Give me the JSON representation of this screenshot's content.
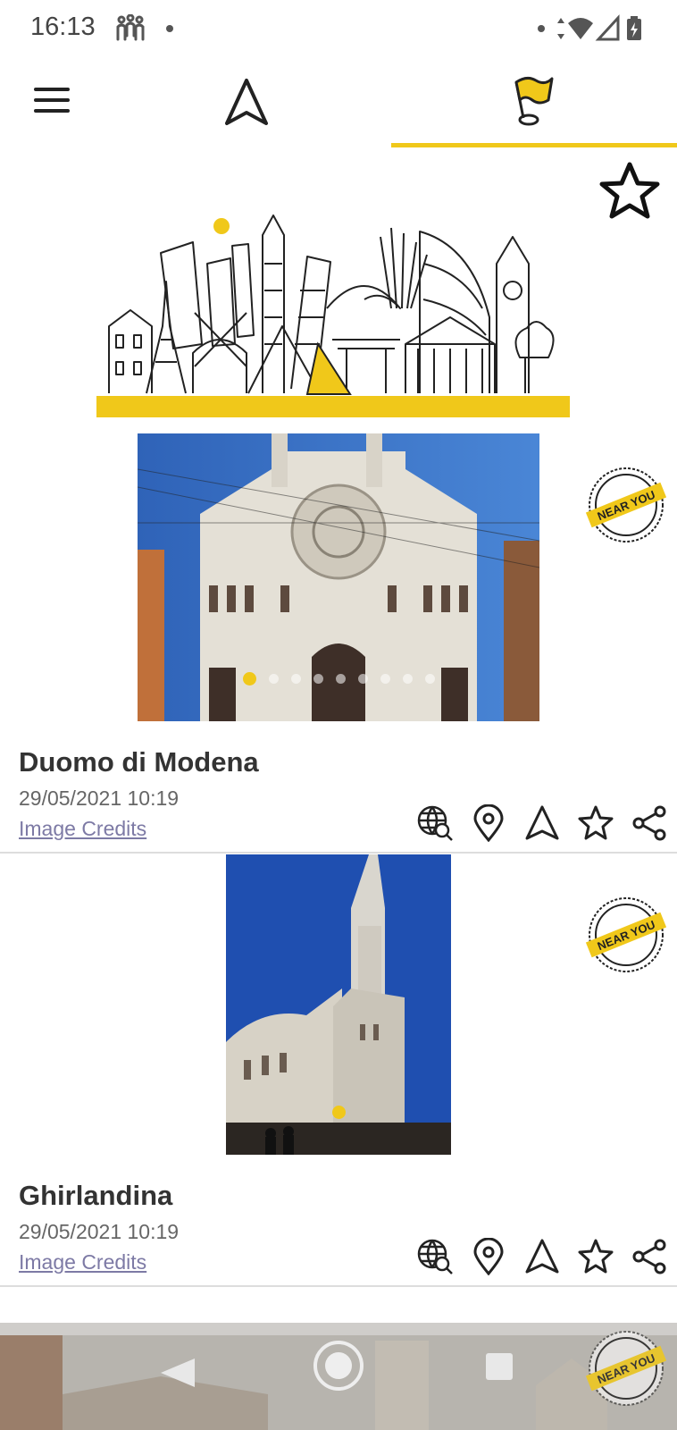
{
  "status_bar": {
    "time": "16:13"
  },
  "toolbar": {
    "menu_icon": "hamburger-menu-icon",
    "navigate_icon": "navigation-arrow-icon",
    "places_icon": "flag-pin-icon",
    "accent": "#f0c81a"
  },
  "places": [
    {
      "title": "Duomo di Modena",
      "date": "29/05/2021 10:19",
      "credits": "Image Credits",
      "badge": "NEAR YOU",
      "photo_count": 9,
      "active_photo": 1
    },
    {
      "title": "Ghirlandina",
      "date": "29/05/2021 10:19",
      "credits": "Image Credits",
      "badge": "NEAR YOU",
      "photo_count": 1,
      "active_photo": 1
    }
  ],
  "next_place": {
    "badge": "NEAR YOU"
  }
}
